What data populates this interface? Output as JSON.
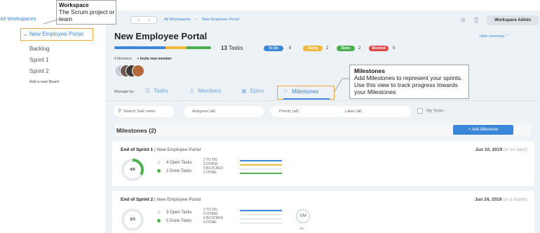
{
  "sidebar": {
    "all_workspaces": "All Workspaces",
    "current_board": "New Employee Portal",
    "items": [
      {
        "label": "Backlog"
      },
      {
        "label": "Sprint 1"
      },
      {
        "label": "Sprint 2"
      }
    ],
    "add_board": "Add a new Board"
  },
  "topbar": {
    "back": "←",
    "forward": "→",
    "breadcrumb_root": "All Workspaces",
    "breadcrumb_sep": ">",
    "breadcrumb_current": "New Employee Portal",
    "workspace_admin": "Workspace Admin"
  },
  "project": {
    "title": "New Employee Portal",
    "hide_summary": "Hide summary ⌃",
    "task_count_num": "13",
    "task_count_label": "Tasks",
    "progress": {
      "todo": 0.53,
      "doing": 0.22,
      "done": 0.25
    },
    "statuses": [
      {
        "label": "To Do",
        "count": "9",
        "color": "#3a86d9"
      },
      {
        "label": "Doing",
        "count": "2",
        "color": "#f0b73e"
      },
      {
        "label": "Done",
        "count": "2",
        "color": "#4caf50"
      },
      {
        "label": "Blocked",
        "count": "0",
        "color": "#e04848"
      }
    ],
    "members_count": "4 Members",
    "invite": "Invite new member",
    "avatars": [
      {
        "initials": "IS",
        "color": "#c9d2db"
      },
      {
        "initials": "",
        "color": "#6b5a4e"
      },
      {
        "initials": "",
        "color": "#3d3a3a"
      },
      {
        "initials": "",
        "color": "#b56a3c"
      }
    ]
  },
  "tabs": {
    "manage_by": "Manage by:",
    "items": [
      {
        "label": "Tasks",
        "icon": "list-icon"
      },
      {
        "label": "Members",
        "icon": "person-icon"
      },
      {
        "label": "Epics",
        "icon": "epic-icon"
      }
    ],
    "active": {
      "label": "Milestones",
      "icon": "flag-icon"
    }
  },
  "filters": {
    "search_placeholder": "Search Task name",
    "assignee": "Assignee (all)",
    "priority": "Priority (all)",
    "label": "Label (all)",
    "my_tasks": "My Tasks"
  },
  "milestones": {
    "header": "Milestones (2)",
    "add_button": "+ Add Milestone",
    "cards": [
      {
        "name": "End of Sprint 1",
        "project": "New Employee Portal",
        "date": "Jun 10, 2019",
        "relative": "(in 14 days)",
        "ring_label": "4/6",
        "ring_fraction": 0.33,
        "open_tasks": "4 Open Tasks",
        "done_tasks": "2 Done Tasks",
        "stats": [
          "2 TO DO",
          "2 DOING",
          "0 BLOCKED",
          "2 DONE"
        ],
        "bars": [
          1,
          1,
          0,
          1
        ]
      },
      {
        "name": "End of Sprint 2",
        "project": "New Employee Portal",
        "date": "Jun 24, 2019",
        "relative": "(in a month)",
        "ring_label": "3/3",
        "ring_fraction": 0,
        "open_tasks": "3 Open Tasks",
        "done_tasks": "0 Done Tasks",
        "stats": [
          "3 TO DO",
          "0 DOING",
          "0 BLOCKED",
          "0 DONE"
        ],
        "bars": [
          1,
          0,
          0,
          0
        ],
        "member_initials": "SM",
        "member_count": "1/1"
      }
    ]
  },
  "callouts": {
    "workspace": {
      "title": "Workspace",
      "body": "The Scrum project or team"
    },
    "milestones": {
      "title": "Milestones",
      "body": "Add Milestones to represent your sprints. Use this view to track progress towards your Milestones"
    }
  },
  "colors": {
    "accent": "#3a86d9",
    "callout_border": "#f0a343",
    "todo": "#3a86d9",
    "doing": "#f0b73e",
    "done": "#4caf50",
    "blocked": "#e04848"
  }
}
